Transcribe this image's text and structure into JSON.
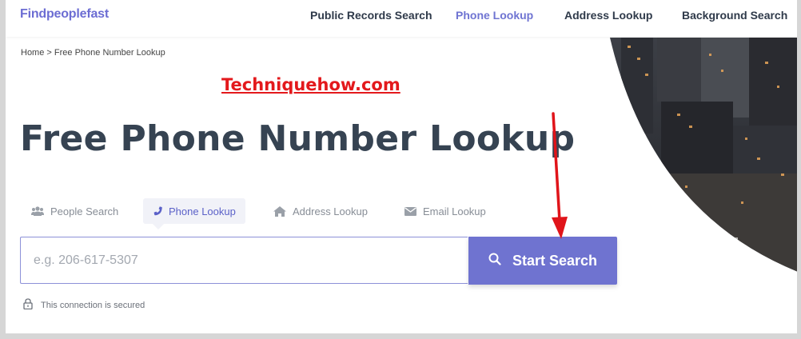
{
  "header": {
    "logo": "Findpeoplefast",
    "nav": [
      "Public Records Search",
      "Phone Lookup",
      "Address Lookup",
      "Background Search"
    ],
    "active_nav": "Phone Lookup"
  },
  "breadcrumb": {
    "home": "Home",
    "separator": ">",
    "current": "Free Phone Number Lookup"
  },
  "watermark": "Techniquehow.com",
  "page_title": "Free Phone Number Lookup",
  "tabs": [
    {
      "label": "People Search",
      "icon": "users-icon"
    },
    {
      "label": "Phone Lookup",
      "icon": "phone-icon",
      "active": true
    },
    {
      "label": "Address Lookup",
      "icon": "home-icon"
    },
    {
      "label": "Email Lookup",
      "icon": "envelope-icon"
    }
  ],
  "search": {
    "placeholder": "e.g. 206-617-5307",
    "value": "",
    "button_label": "Start Search"
  },
  "security_note": "This connection is secured",
  "colors": {
    "accent": "#6f73d0",
    "title": "#364352",
    "watermark": "#e3191c",
    "arrow": "#e0141a"
  }
}
